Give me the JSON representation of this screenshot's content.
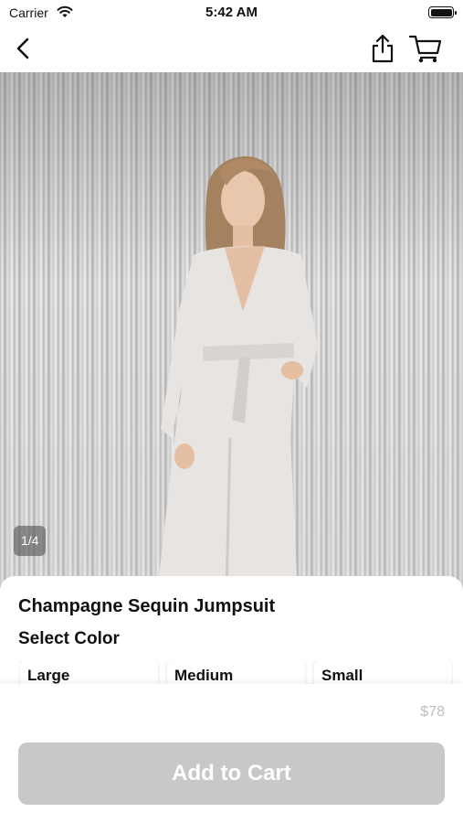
{
  "status_bar": {
    "carrier": "Carrier",
    "time": "5:42 AM"
  },
  "nav": {
    "back_icon": "chevron-left-icon",
    "share_icon": "share-icon",
    "cart_icon": "cart-icon"
  },
  "gallery": {
    "counter": "1/4"
  },
  "product": {
    "title": "Champagne Sequin Jumpsuit",
    "select_label": "Select Color",
    "options": [
      "Large",
      "Medium",
      "Small"
    ],
    "price": "$78"
  },
  "footer": {
    "add_to_cart_label": "Add to Cart"
  },
  "colors": {
    "button_disabled": "#c8c8c8",
    "price_text": "#bdbdbd",
    "counter_bg": "#5a5a5a"
  }
}
